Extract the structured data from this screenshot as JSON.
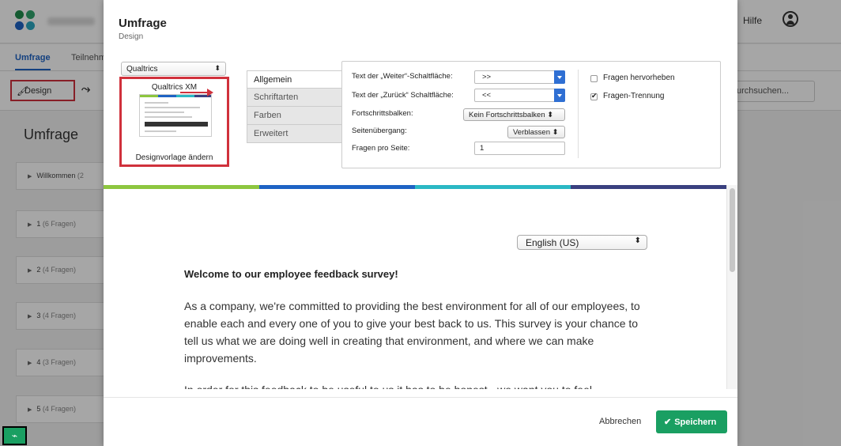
{
  "app": {
    "help_label": "Hilfe",
    "nav_tabs": [
      "Umfrage",
      "Teilnehm"
    ],
    "toolbar": {
      "design_label": "Design",
      "search_placeholder": "urchsuchen..."
    },
    "page_title": "Umfrage",
    "blocks": [
      {
        "name": "Willkommen",
        "count": "(2"
      },
      {
        "name": "1",
        "count": "(6 Fragen)"
      },
      {
        "name": "2",
        "count": "(4 Fragen)"
      },
      {
        "name": "3",
        "count": "(4 Fragen)"
      },
      {
        "name": "4",
        "count": "(3 Fragen)"
      },
      {
        "name": "5",
        "count": "(4 Fragen)"
      }
    ]
  },
  "modal": {
    "title": "Umfrage",
    "subtitle": "Design",
    "theme_select": "Qualtrics",
    "theme_name": "Qualtrics XM",
    "change_template": "Designvorlage ändern",
    "side_tabs": [
      "Allgemein",
      "Schriftarten",
      "Farben",
      "Erweitert"
    ],
    "settings": {
      "next_label": "Text der „Weiter“-Schaltfläche:",
      "next_value": ">>",
      "back_label": "Text der „Zurück“ Schaltfläche:",
      "back_value": "<<",
      "progress_label": "Fortschrittsbalken:",
      "progress_value": "Kein Fortschrittsbalken",
      "transition_label": "Seitenübergang:",
      "transition_value": "Verblassen",
      "per_page_label": "Fragen pro Seite:",
      "per_page_value": "1",
      "highlight_label": "Fragen hervorheben",
      "highlight_checked": false,
      "separator_label": "Fragen-Trennung",
      "separator_checked": true
    },
    "preview": {
      "language": "English (US)",
      "welcome": "Welcome to our employee feedback survey!",
      "paragraph": "As a company, we're committed to providing the best environment for all of our employees, to enable each and every one of you to give your best back to us. This survey is your chance to tell us what we are doing well in creating that environment, and where we can make improvements.",
      "paragraph_cut": "In order for this feedback to be useful to us it has to be honest - we want you to feel"
    },
    "cancel_label": "Abbrechen",
    "save_label": "Speichern"
  },
  "colors": {
    "accent_red": "#d0313c",
    "save_green": "#1a9f62",
    "select_blue": "#2f6fd3"
  }
}
